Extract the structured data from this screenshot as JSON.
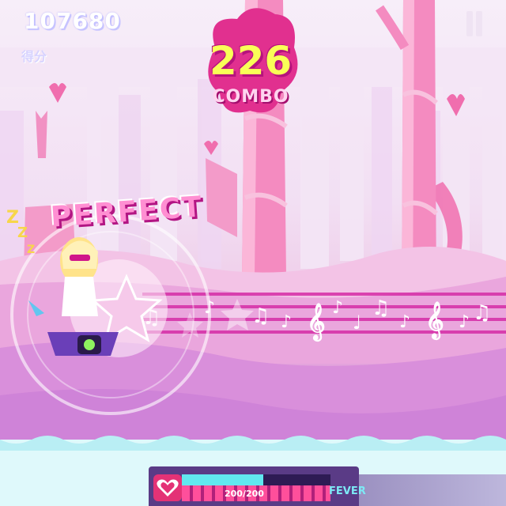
{
  "hud": {
    "score": "107680",
    "score_label": "得分",
    "combo_count": "226",
    "combo_label": "COMBO",
    "judgement": "PERFECT"
  },
  "fever": {
    "count": "200/200",
    "label": "FEVER",
    "fill_fraction": 0.55
  },
  "icons": [
    "pause-icon",
    "heart-icon",
    "music-note-icon",
    "treble-clef-icon",
    "star-icon",
    "speaker-icon"
  ],
  "colors": {
    "combo_number": "#f9ff57",
    "combo_blob": "#e1308f",
    "perfect_text": "#ff8fd2",
    "fever_fill": "#61e8ef",
    "lane_line": "#d62ca6"
  }
}
